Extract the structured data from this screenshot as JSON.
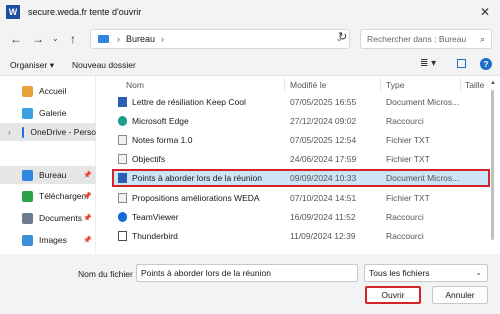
{
  "window": {
    "title": "secure.weda.fr tente d'ouvrir",
    "logo": "W"
  },
  "nav": {
    "location": "Bureau",
    "search_placeholder": "Rechercher dans : Bureau"
  },
  "toolbar": {
    "organize": "Organiser",
    "new_folder": "Nouveau dossier"
  },
  "sidebar": {
    "items": [
      {
        "label": "Accueil",
        "icon": "home-icon"
      },
      {
        "label": "Galerie",
        "icon": "gallery-icon"
      },
      {
        "label": "OneDrive - Perso",
        "icon": "cloud-icon"
      },
      {
        "label": "Bureau",
        "icon": "desktop-icon"
      },
      {
        "label": "Téléchargem",
        "icon": "download-icon"
      },
      {
        "label": "Documents",
        "icon": "documents-icon"
      },
      {
        "label": "Images",
        "icon": "images-icon"
      }
    ]
  },
  "columns": {
    "name": "Nom",
    "modified": "Modifié le",
    "type": "Type",
    "size": "Taille"
  },
  "files": [
    {
      "name": "Lettre de résiliation Keep Cool",
      "modified": "07/05/2025 16:55",
      "type": "Document Micros...",
      "icon_color": "#2b5fb4"
    },
    {
      "name": "Microsoft Edge",
      "modified": "27/12/2024 09:02",
      "type": "Raccourci",
      "icon_color": "#1f9c8a"
    },
    {
      "name": "Notes forma 1.0",
      "modified": "07/05/2025 12:54",
      "type": "Fichier TXT",
      "icon_color": "#8a8a8a"
    },
    {
      "name": "Objectifs",
      "modified": "24/06/2024 17:59",
      "type": "Fichier TXT",
      "icon_color": "#8a8a8a"
    },
    {
      "name": "Points à aborder lors de la réunion",
      "modified": "09/09/2024 10:33",
      "type": "Document Micros...",
      "icon_color": "#2b5fb4"
    },
    {
      "name": "Propositions améliorations WEDA",
      "modified": "07/10/2024 14:51",
      "type": "Fichier TXT",
      "icon_color": "#8a8a8a"
    },
    {
      "name": "TeamViewer",
      "modified": "16/09/2024 11:52",
      "type": "Raccourci",
      "icon_color": "#1668d8"
    },
    {
      "name": "Thunderbird",
      "modified": "11/09/2024 12:39",
      "type": "Raccourci",
      "icon_color": "#4a4a4a"
    }
  ],
  "bottom": {
    "filename_label": "Nom du fichier :",
    "filename_value": "Points à aborder lors de la réunion",
    "filetype": "Tous les fichiers",
    "open": "Ouvrir",
    "cancel": "Annuler"
  },
  "colors": {
    "selection_bg": "#cce4f7",
    "highlight_border": "#d3242a",
    "accent": "#1e6ec8"
  }
}
